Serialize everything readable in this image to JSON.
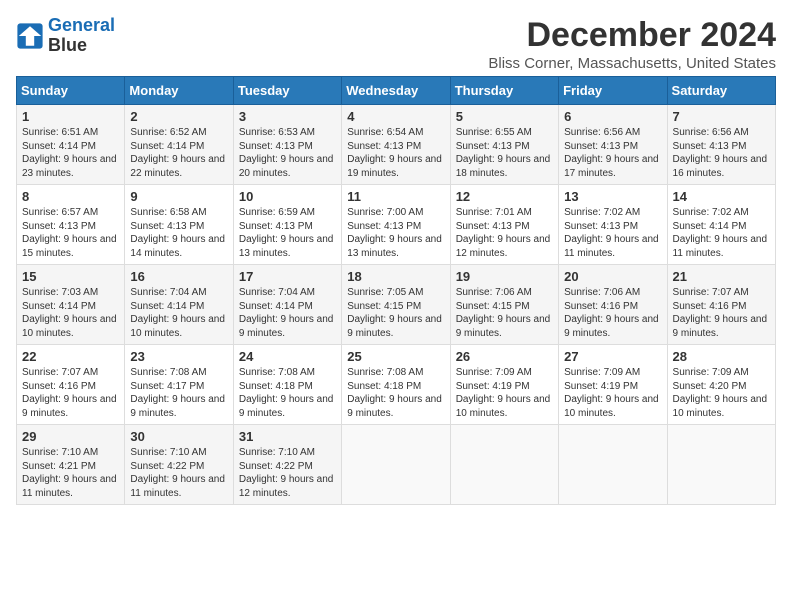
{
  "logo": {
    "line1": "General",
    "line2": "Blue"
  },
  "title": "December 2024",
  "location": "Bliss Corner, Massachusetts, United States",
  "weekdays": [
    "Sunday",
    "Monday",
    "Tuesday",
    "Wednesday",
    "Thursday",
    "Friday",
    "Saturday"
  ],
  "weeks": [
    [
      {
        "day": "1",
        "info": "Sunrise: 6:51 AM\nSunset: 4:14 PM\nDaylight: 9 hours and 23 minutes."
      },
      {
        "day": "2",
        "info": "Sunrise: 6:52 AM\nSunset: 4:14 PM\nDaylight: 9 hours and 22 minutes."
      },
      {
        "day": "3",
        "info": "Sunrise: 6:53 AM\nSunset: 4:13 PM\nDaylight: 9 hours and 20 minutes."
      },
      {
        "day": "4",
        "info": "Sunrise: 6:54 AM\nSunset: 4:13 PM\nDaylight: 9 hours and 19 minutes."
      },
      {
        "day": "5",
        "info": "Sunrise: 6:55 AM\nSunset: 4:13 PM\nDaylight: 9 hours and 18 minutes."
      },
      {
        "day": "6",
        "info": "Sunrise: 6:56 AM\nSunset: 4:13 PM\nDaylight: 9 hours and 17 minutes."
      },
      {
        "day": "7",
        "info": "Sunrise: 6:56 AM\nSunset: 4:13 PM\nDaylight: 9 hours and 16 minutes."
      }
    ],
    [
      {
        "day": "8",
        "info": "Sunrise: 6:57 AM\nSunset: 4:13 PM\nDaylight: 9 hours and 15 minutes."
      },
      {
        "day": "9",
        "info": "Sunrise: 6:58 AM\nSunset: 4:13 PM\nDaylight: 9 hours and 14 minutes."
      },
      {
        "day": "10",
        "info": "Sunrise: 6:59 AM\nSunset: 4:13 PM\nDaylight: 9 hours and 13 minutes."
      },
      {
        "day": "11",
        "info": "Sunrise: 7:00 AM\nSunset: 4:13 PM\nDaylight: 9 hours and 13 minutes."
      },
      {
        "day": "12",
        "info": "Sunrise: 7:01 AM\nSunset: 4:13 PM\nDaylight: 9 hours and 12 minutes."
      },
      {
        "day": "13",
        "info": "Sunrise: 7:02 AM\nSunset: 4:13 PM\nDaylight: 9 hours and 11 minutes."
      },
      {
        "day": "14",
        "info": "Sunrise: 7:02 AM\nSunset: 4:14 PM\nDaylight: 9 hours and 11 minutes."
      }
    ],
    [
      {
        "day": "15",
        "info": "Sunrise: 7:03 AM\nSunset: 4:14 PM\nDaylight: 9 hours and 10 minutes."
      },
      {
        "day": "16",
        "info": "Sunrise: 7:04 AM\nSunset: 4:14 PM\nDaylight: 9 hours and 10 minutes."
      },
      {
        "day": "17",
        "info": "Sunrise: 7:04 AM\nSunset: 4:14 PM\nDaylight: 9 hours and 9 minutes."
      },
      {
        "day": "18",
        "info": "Sunrise: 7:05 AM\nSunset: 4:15 PM\nDaylight: 9 hours and 9 minutes."
      },
      {
        "day": "19",
        "info": "Sunrise: 7:06 AM\nSunset: 4:15 PM\nDaylight: 9 hours and 9 minutes."
      },
      {
        "day": "20",
        "info": "Sunrise: 7:06 AM\nSunset: 4:16 PM\nDaylight: 9 hours and 9 minutes."
      },
      {
        "day": "21",
        "info": "Sunrise: 7:07 AM\nSunset: 4:16 PM\nDaylight: 9 hours and 9 minutes."
      }
    ],
    [
      {
        "day": "22",
        "info": "Sunrise: 7:07 AM\nSunset: 4:16 PM\nDaylight: 9 hours and 9 minutes."
      },
      {
        "day": "23",
        "info": "Sunrise: 7:08 AM\nSunset: 4:17 PM\nDaylight: 9 hours and 9 minutes."
      },
      {
        "day": "24",
        "info": "Sunrise: 7:08 AM\nSunset: 4:18 PM\nDaylight: 9 hours and 9 minutes."
      },
      {
        "day": "25",
        "info": "Sunrise: 7:08 AM\nSunset: 4:18 PM\nDaylight: 9 hours and 9 minutes."
      },
      {
        "day": "26",
        "info": "Sunrise: 7:09 AM\nSunset: 4:19 PM\nDaylight: 9 hours and 10 minutes."
      },
      {
        "day": "27",
        "info": "Sunrise: 7:09 AM\nSunset: 4:19 PM\nDaylight: 9 hours and 10 minutes."
      },
      {
        "day": "28",
        "info": "Sunrise: 7:09 AM\nSunset: 4:20 PM\nDaylight: 9 hours and 10 minutes."
      }
    ],
    [
      {
        "day": "29",
        "info": "Sunrise: 7:10 AM\nSunset: 4:21 PM\nDaylight: 9 hours and 11 minutes."
      },
      {
        "day": "30",
        "info": "Sunrise: 7:10 AM\nSunset: 4:22 PM\nDaylight: 9 hours and 11 minutes."
      },
      {
        "day": "31",
        "info": "Sunrise: 7:10 AM\nSunset: 4:22 PM\nDaylight: 9 hours and 12 minutes."
      },
      {
        "day": "",
        "info": ""
      },
      {
        "day": "",
        "info": ""
      },
      {
        "day": "",
        "info": ""
      },
      {
        "day": "",
        "info": ""
      }
    ]
  ]
}
